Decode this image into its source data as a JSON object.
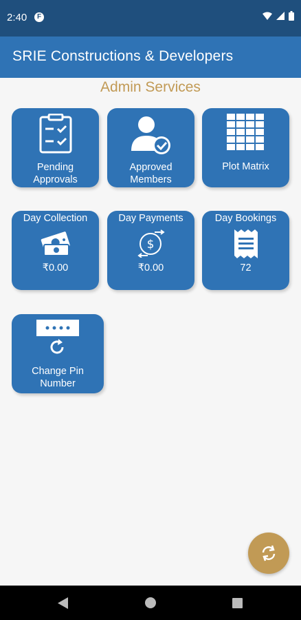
{
  "status_bar": {
    "time": "2:40",
    "app_icon": "F"
  },
  "app_bar": {
    "title": "SRIE Constructions & Developers"
  },
  "section": {
    "title": "Admin Services"
  },
  "tiles": {
    "pending": {
      "label_line1": "Pending",
      "label_line2": "Approvals",
      "icon": "clipboard-checklist-icon"
    },
    "approved": {
      "label_line1": "Approved",
      "label_line2": "Members",
      "icon": "user-check-icon"
    },
    "plot": {
      "label": "Plot Matrix",
      "icon": "grid-table-icon"
    },
    "day_collection": {
      "header": "Day Collection",
      "value": "₹0.00",
      "icon": "cash-money-icon"
    },
    "day_payments": {
      "header": "Day Payments",
      "value": "₹0.00",
      "icon": "dollar-exchange-icon"
    },
    "day_bookings": {
      "header": "Day Bookings",
      "value": "72",
      "icon": "receipt-icon"
    },
    "change_pin": {
      "label_line1": "Change Pin",
      "label_line2": "Number",
      "icon": "pin-refresh-icon"
    }
  },
  "fab": {
    "icon": "refresh-icon"
  },
  "nav": {
    "back": "back-icon",
    "home": "home-icon",
    "recents": "recents-icon"
  },
  "colors": {
    "primary": "#2f73b5",
    "status_bar": "#1f4f7d",
    "accent_gold": "#c19a55",
    "background": "#f6f6f6"
  }
}
